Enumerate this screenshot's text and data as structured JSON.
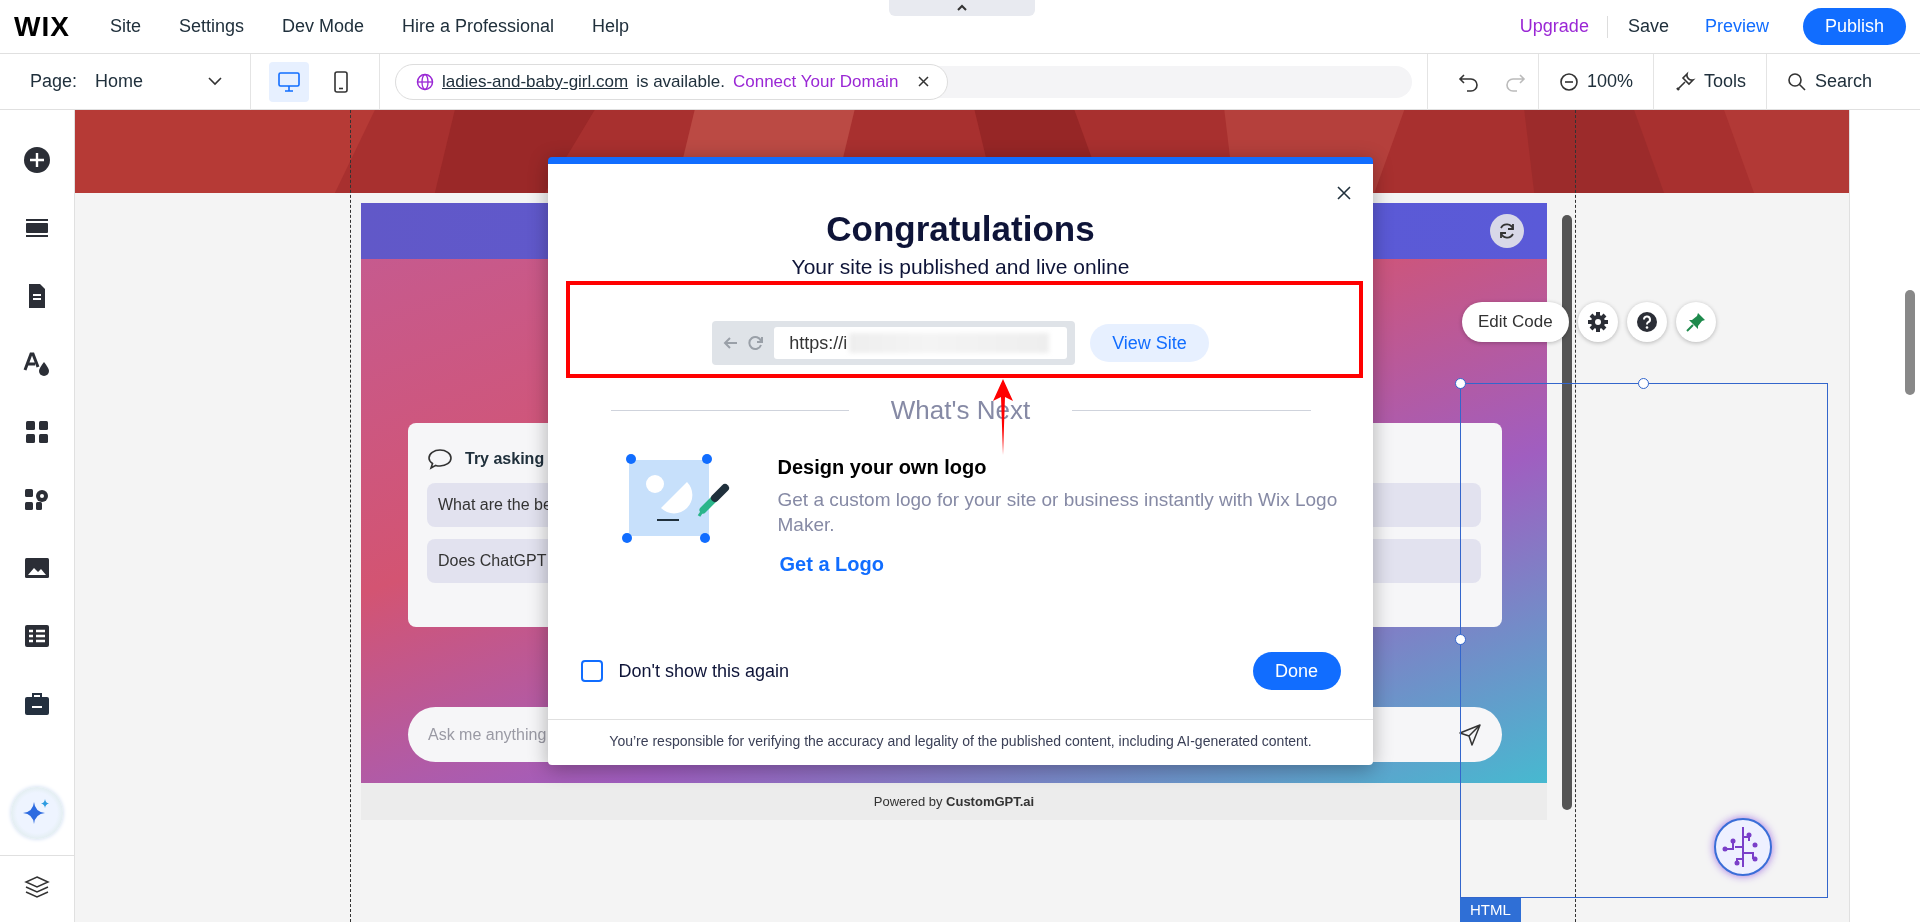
{
  "top_bar": {
    "logo": "WIX",
    "menu": [
      "Site",
      "Settings",
      "Dev Mode",
      "Hire a Professional",
      "Help"
    ],
    "upgrade": "Upgrade",
    "save": "Save",
    "preview": "Preview",
    "publish": "Publish"
  },
  "toolbar": {
    "page_label": "Page:",
    "page": "Home",
    "devices": [
      {
        "selected": true
      },
      {
        "selected": false
      }
    ],
    "domain": "ladies-and-baby-girl.com",
    "domain_status": "is available.",
    "connect": "Connect Your Domain",
    "zoom": "100%",
    "tools": "Tools",
    "search": "Search"
  },
  "canvas": {
    "chat": {
      "suggest_title": "Try asking",
      "suggestions": [
        "What are the be",
        "Does ChatGPT"
      ],
      "input_placeholder": "Ask me anything",
      "powered_by": "Powered by **CustomGPT.ai**"
    },
    "edit_code": "Edit Code",
    "element_tag": "HTML"
  },
  "modal": {
    "title": "Congratulations",
    "subtitle": "Your site is published and live online",
    "url": "https://i",
    "view_site": "View Site",
    "section_title": "What's Next",
    "card_title": "Design your own logo",
    "card_text": "Get a custom logo for your site or business instantly with Wix Logo Maker.",
    "card_link": "Get a Logo",
    "dont_show": {
      "label": "Don't show this again",
      "checked": false
    },
    "done": "Done",
    "footer": "You’re responsible for verifying the accuracy and legality of the published content, including AI-generated content."
  }
}
